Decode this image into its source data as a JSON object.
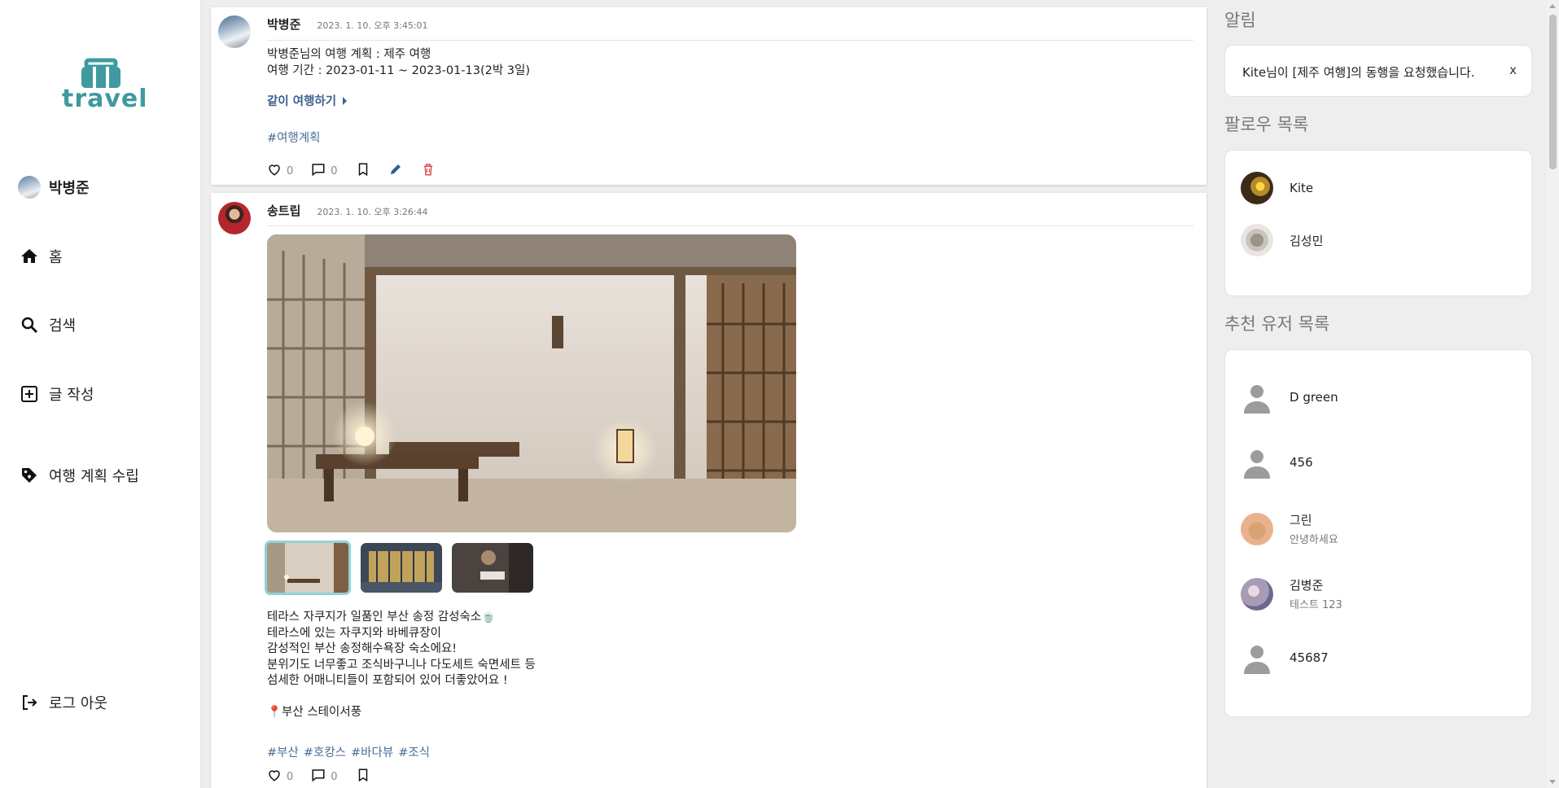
{
  "app": {
    "logo_text": "travel"
  },
  "sidebar": {
    "profile_name": "박병준",
    "items": [
      {
        "label": "홈",
        "icon": "home-icon"
      },
      {
        "label": "검색",
        "icon": "search-icon"
      },
      {
        "label": "글 작성",
        "icon": "add-box-icon"
      },
      {
        "label": "여행 계획 수립",
        "icon": "tag-icon"
      }
    ],
    "logout_label": "로그 아웃"
  },
  "feed": {
    "posts": [
      {
        "author": "박병준",
        "time": "2023. 1. 10. 오후 3:45:01",
        "body": "박병준님의 여행 계획 : 제주 여행\n여행 기간 : 2023-01-11 ~ 2023-01-13(2박 3일)",
        "join_label": "같이 여행하기",
        "tags": [
          "#여행계획"
        ],
        "likes": "0",
        "comments": "0"
      },
      {
        "author": "송트립",
        "time": "2023. 1. 10. 오후 3:26:44",
        "body": "테라스 자쿠지가 일품인 부산 송정 감성숙소🍵\n테라스에 있는 자쿠지와 바베큐장이\n감성적인 부산 송정해수욕장 숙소에요!\n분위기도 너무좋고 조식바구니나 다도세트 숙면세트 등\n섬세한 어매니티들이 포함되어 있어 더좋았어요 !\n\n📍부산 스테이서풍",
        "tags": [
          "#부산",
          "#호캉스",
          "#바다뷰",
          "#조식"
        ],
        "likes": "0",
        "comments": "0"
      }
    ]
  },
  "right": {
    "notifications_title": "알림",
    "notification_text": "Kite님이 [제주 여행]의 동행을 요청했습니다.",
    "notification_close": "x",
    "follow_title": "팔로우 목록",
    "follow": [
      {
        "name": "Kite"
      },
      {
        "name": "김성민"
      }
    ],
    "recommend_title": "추천 유저 목록",
    "recommend": [
      {
        "name": "D green",
        "sub": ""
      },
      {
        "name": "456",
        "sub": ""
      },
      {
        "name": "그린",
        "sub": "안녕하세요"
      },
      {
        "name": "김병준",
        "sub": "테스트 123"
      },
      {
        "name": "45687",
        "sub": ""
      }
    ]
  },
  "colors": {
    "accent": "#3e9aa0",
    "link": "#3b5f8e",
    "tag": "#4a6f99",
    "delete": "#d9534f",
    "edit": "#2d5f93"
  }
}
